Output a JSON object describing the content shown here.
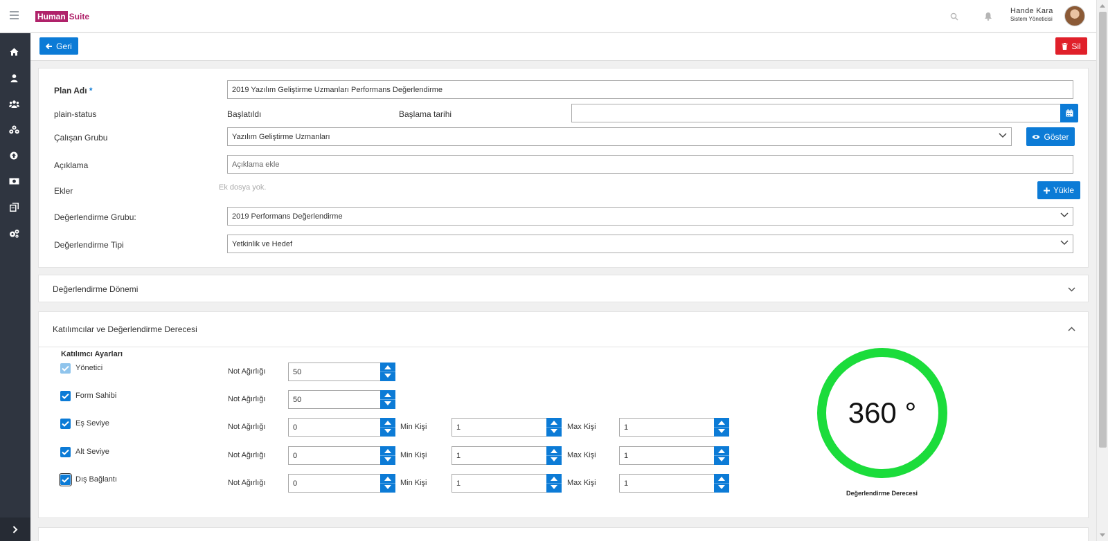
{
  "header": {
    "logo_part1": "Human",
    "logo_part2": "Suite",
    "user_name": "Hande Kara",
    "user_role": "Sistem Yöneticisi"
  },
  "sidebar": {
    "icons": [
      "home-icon",
      "user-icon",
      "users-icon",
      "org-icon",
      "upload-circle-icon",
      "money-icon",
      "documents-icon",
      "settings-icon"
    ]
  },
  "actions": {
    "back_label": "Geri",
    "delete_label": "Sil"
  },
  "form": {
    "plan_name_label": "Plan Adı",
    "plan_name_required": "*",
    "plan_name_value": "2019 Yazılım Geliştirme Uzmanları Performans Değerlendirme",
    "status_label": "plain-status",
    "status_value": "Başlatıldı",
    "start_date_label": "Başlama tarihi",
    "employee_group_label": "Çalışan Grubu",
    "employee_group_value": "Yazılım Geliştirme Uzmanları",
    "show_label": "Göster",
    "description_label": "Açıklama",
    "description_placeholder": "Açıklama ekle",
    "attachments_label": "Ekler",
    "no_attachments": "Ek dosya yok.",
    "upload_label": "Yükle",
    "eval_group_label": "Değerlendirme Grubu:",
    "eval_group_value": "2019 Performans Değerlendirme",
    "eval_type_label": "Değerlendirme Tipi",
    "eval_type_value": "Yetkinlik ve Hedef"
  },
  "accordions": {
    "period_title": "Değerlendirme Dönemi",
    "participants_title": "Katılımcılar ve Değerlendirme Derecesi"
  },
  "participants": {
    "section_title": "Katılımcı Ayarları",
    "weight_label": "Not Ağırlığı",
    "min_label": "Min Kişi",
    "max_label": "Max Kişi",
    "rows": [
      {
        "name": "Yönetici",
        "checked": true,
        "weight": "50"
      },
      {
        "name": "Form Sahibi",
        "checked": true,
        "weight": "50"
      },
      {
        "name": "Eş Seviye",
        "checked": true,
        "weight": "0",
        "min": "1",
        "max": "1"
      },
      {
        "name": "Alt Seviye",
        "checked": true,
        "weight": "0",
        "min": "1",
        "max": "1"
      },
      {
        "name": "Dış Bağlantı",
        "checked": true,
        "weight": "0",
        "min": "1",
        "max": "1"
      }
    ]
  },
  "degree": {
    "value": "360 °",
    "label": "Değerlendirme Derecesi",
    "ring_color": "#1bdc3b"
  },
  "colors": {
    "primary": "#0c7bd6",
    "danger": "#e0202a",
    "sidebar": "#2f3540",
    "brand": "#b0226a"
  }
}
